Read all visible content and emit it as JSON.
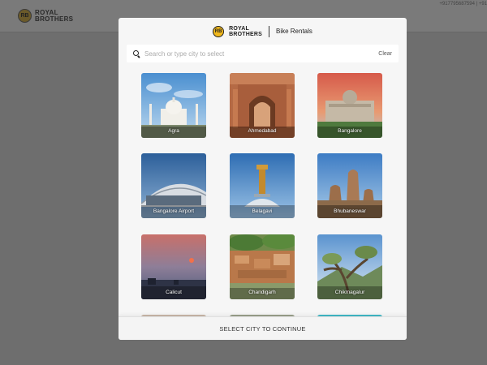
{
  "background": {
    "logo": {
      "badge": "RB",
      "line1": "ROYAL",
      "line2": "BROTHERS"
    },
    "phone": "+917795687594 | +91"
  },
  "modal": {
    "brand": {
      "badge": "RB",
      "line1": "ROYAL",
      "line2": "BROTHERS",
      "subtitle": "Bike Rentals"
    },
    "search": {
      "placeholder": "Search or type city to select",
      "value": "",
      "clear_label": "Clear"
    },
    "cities": [
      {
        "name": "Agra",
        "icon": "taj-mahal"
      },
      {
        "name": "Ahmedabad",
        "icon": "temple-arch"
      },
      {
        "name": "Bangalore",
        "icon": "vidhana-soudha"
      },
      {
        "name": "Bangalore Airport",
        "icon": "airport-terminal"
      },
      {
        "name": "Belagavi",
        "icon": "monument-statue"
      },
      {
        "name": "Bhubaneswar",
        "icon": "lingaraj-temple"
      },
      {
        "name": "Calicut",
        "icon": "sunset-beach"
      },
      {
        "name": "Chandigarh",
        "icon": "rock-garden"
      },
      {
        "name": "Chikmagalur",
        "icon": "hill-tree"
      }
    ],
    "footer_label": "SELECT CITY TO CONTINUE"
  },
  "colors": {
    "brand_yellow": "#f1b81b",
    "overlay": "#6e6e6e",
    "modal_bg": "#f6f6f6"
  }
}
